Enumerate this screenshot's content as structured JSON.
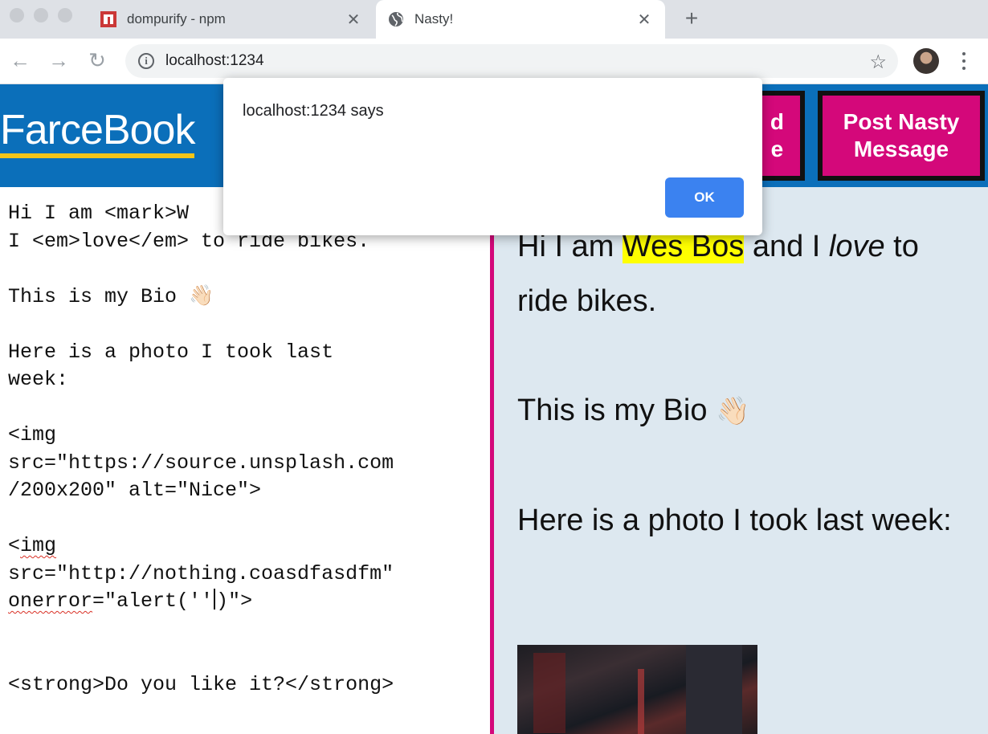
{
  "browser": {
    "tabs": [
      {
        "title": "dompurify - npm",
        "icon": "npm-icon",
        "active": false
      },
      {
        "title": "Nasty!",
        "icon": "globe-icon",
        "active": true
      }
    ],
    "new_tab_label": "+",
    "url": "localhost:1234"
  },
  "header": {
    "logo": "FarceBook",
    "button_partial_line1": "d",
    "button_partial_line2": "e",
    "button_post_line1": "Post Nasty",
    "button_post_line2": "Message"
  },
  "editor": {
    "lines": {
      "l1": "Hi I am <mark>W",
      "l2": "I <em>love</em> to ride bikes.",
      "l3_text": "This is my Bio ",
      "emoji": "👋🏻",
      "l4": "Here is a photo I took last",
      "l5": "week:",
      "l6": "<img",
      "l7": "src=\"https://source.unsplash.com",
      "l8": "/200x200\" alt=\"Nice\">",
      "l9_lt": "<",
      "l9_word": "img",
      "l10": "src=\"http://nothing.coasdfasdfm\"",
      "l11_word": "onerror",
      "l11_a": "=\"alert(''",
      "l11_b": ")\">",
      "l12": "<strong>Do you like it?</strong>"
    }
  },
  "preview": {
    "p1_a": "Hi I am ",
    "p1_mark": "Wes Bos",
    "p1_b": " and I ",
    "p1_em": "love",
    "p1_c": " to ride bikes.",
    "p2_text": "This is my Bio ",
    "p2_emoji": "👋🏻",
    "p3": "Here is a photo I took last week:"
  },
  "dialog": {
    "message": "localhost:1234 says",
    "ok_label": "OK"
  },
  "colors": {
    "header_blue": "#0b6fba",
    "accent_pink": "#d4087a",
    "logo_underline": "#f5c518",
    "preview_bg": "#dde8f0",
    "ok_button": "#3b82f0"
  }
}
